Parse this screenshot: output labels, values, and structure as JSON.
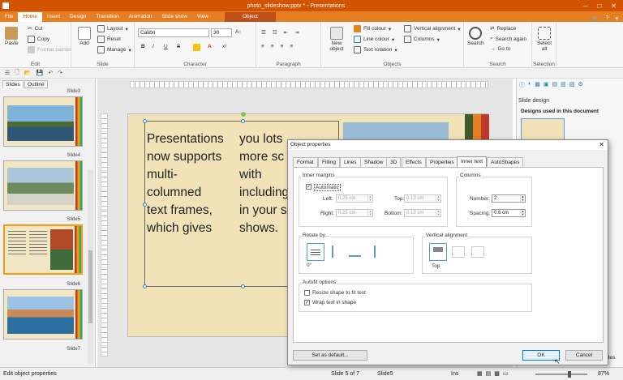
{
  "title_bar": {
    "title": "photo_slideshow.pptx * - Presentations"
  },
  "menu": {
    "tabs": [
      "File",
      "Home",
      "Insert",
      "Design",
      "Transition",
      "Animation",
      "Slide show",
      "View"
    ],
    "context_tab": "Object"
  },
  "ribbon": {
    "edit": {
      "paste": "Paste",
      "cut": "Cut",
      "copy": "Copy",
      "format_painter": "Format painter",
      "label": "Edit"
    },
    "slide": {
      "add": "Add",
      "layout": "Layout",
      "reset": "Reset",
      "manage": "Manage",
      "label": "Slide"
    },
    "character": {
      "font": "Calibri",
      "size": "30",
      "bold": "B",
      "italic": "I",
      "underline": "U",
      "strike": "S",
      "label": "Character"
    },
    "paragraph": {
      "label": "Paragraph"
    },
    "objects": {
      "new_object": "New object",
      "fill_colour": "Fill colour",
      "line_colour": "Line colour",
      "text_rotation": "Text rotation",
      "vertical_alignment": "Vertical alignment",
      "columns": "Columns",
      "label": "Objects"
    },
    "search": {
      "search": "Search",
      "replace": "Replace",
      "search_again": "Search again",
      "go_to": "Go to",
      "label": "Search"
    },
    "selection": {
      "select_all": "Select all",
      "label": "Selection"
    }
  },
  "slides_panel": {
    "tabs": [
      "Slides",
      "Outline"
    ],
    "slides": [
      {
        "label": "Slide3"
      },
      {
        "label": "Slide4"
      },
      {
        "label": "Slide5"
      },
      {
        "label": "Slide6"
      },
      {
        "label": "Slide7"
      }
    ]
  },
  "slide": {
    "col1": [
      "Presentations",
      "now supports",
      "multi-",
      "columned",
      "text frames,",
      "which gives"
    ],
    "col2": [
      "you lots",
      "more sc",
      "with",
      "including",
      "in your s",
      "shows."
    ]
  },
  "right_pane": {
    "header": "Slide design",
    "sub": "Designs used in this document",
    "tab_fragment": "lides"
  },
  "dialog": {
    "title": "Object properties",
    "tabs": [
      "Format",
      "Filling",
      "Lines",
      "Shadow",
      "3D",
      "Effects",
      "Properties",
      "Inner text",
      "AutoShapes"
    ],
    "active_tab": "Inner text",
    "inner_margins": {
      "label": "Inner margins",
      "automatic": "Automatic",
      "left_label": "Left:",
      "left": "0.25 cm",
      "top_label": "Top:",
      "top": "0.13 cm",
      "right_label": "Right:",
      "right": "0.25 cm",
      "bottom_label": "Bottom:",
      "bottom": "0.13 cm"
    },
    "columns": {
      "label": "Columns",
      "number_label": "Number:",
      "number": "2",
      "spacing_label": "Spacing:",
      "spacing": "0.6 cm"
    },
    "rotate": {
      "label": "Rotate by...",
      "value": "0°"
    },
    "vertical_alignment": {
      "label": "Vertical alignment",
      "value": "Top"
    },
    "autofit": {
      "label": "Autofit options",
      "resize": "Resize shape to fit text",
      "wrap": "Wrap text in shape"
    },
    "buttons": {
      "set_default": "Set as default...",
      "ok": "OK",
      "cancel": "Cancel"
    }
  },
  "status": {
    "left": "Edit object properties",
    "slide": "Slide 5 of 7",
    "name": "Slide5",
    "mode": "Ins",
    "zoom": "87%"
  }
}
